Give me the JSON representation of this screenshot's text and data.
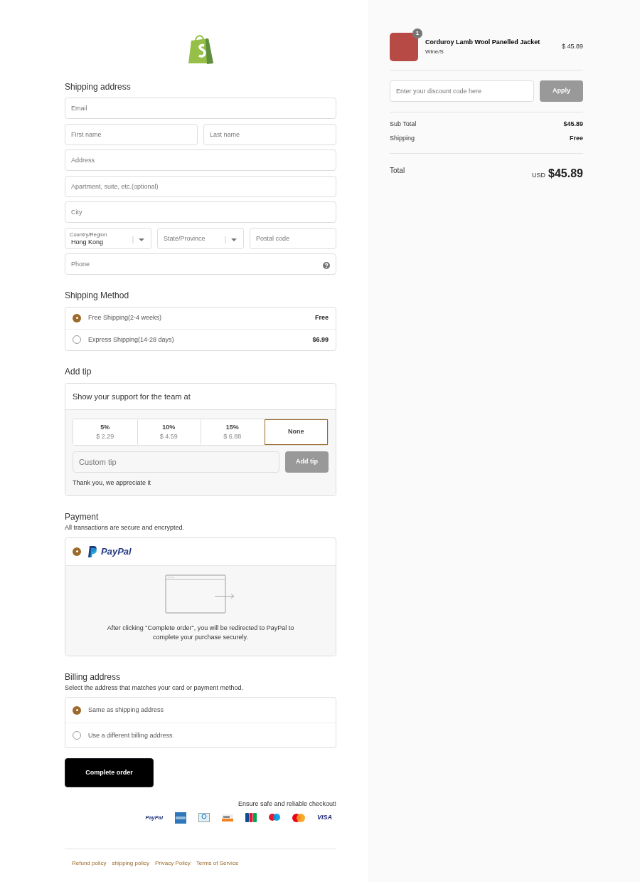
{
  "shipping_address": {
    "title": "Shipping address",
    "rows": [
      [
        {
          "kind": "text",
          "placeholder": "Email"
        }
      ],
      [
        {
          "kind": "text",
          "placeholder": "First name"
        },
        {
          "kind": "text",
          "placeholder": "Last name"
        }
      ],
      [
        {
          "kind": "text",
          "placeholder": "Address"
        }
      ],
      [
        {
          "kind": "text",
          "placeholder": "Apartment, suite, etc.(optional)"
        }
      ],
      [
        {
          "kind": "text",
          "placeholder": "City"
        }
      ],
      [
        {
          "kind": "select",
          "label": "Country/Region",
          "value": "Hong Kong"
        },
        {
          "kind": "select",
          "placeholder": "State/Province"
        },
        {
          "kind": "text",
          "placeholder": "Postal code"
        }
      ],
      [
        {
          "kind": "help",
          "placeholder": "Phone"
        }
      ]
    ]
  },
  "shipping_method": {
    "title": "Shipping Method",
    "options": [
      {
        "label": "Free Shipping(2-4 weeks)",
        "price": "Free",
        "selected": true
      },
      {
        "label": "Express Shipping(14-28 days)",
        "price": "$6.99",
        "selected": false
      }
    ]
  },
  "tip": {
    "title": "Add tip",
    "prompt": "Show your support for the team at",
    "options": [
      {
        "label": "5%",
        "amount": "$ 2.29",
        "selected": false
      },
      {
        "label": "10%",
        "amount": "$ 4.59",
        "selected": false
      },
      {
        "label": "15%",
        "amount": "$ 6.88",
        "selected": false
      },
      {
        "label": "None",
        "selected": true
      }
    ],
    "custom_placeholder": "Custom tip",
    "button": {
      "label": "Add tip",
      "disabled": true
    },
    "note": "Thank you, we appreciate it"
  },
  "payment": {
    "title": "Payment",
    "subtitle": "All transactions are secure and encrypted.",
    "methods": [
      {
        "label": "PayPal",
        "selected": true
      }
    ],
    "message": "After clicking \"Complete order\", you will be redirected to PayPal to complete your purchase securely."
  },
  "billing": {
    "title": "Billing address",
    "subtitle": "Select the address that matches your card or payment method.",
    "options": [
      {
        "label": "Same as shipping address",
        "selected": true
      },
      {
        "label": "Use a different billing address",
        "selected": false
      }
    ]
  },
  "complete_button": "Complete order",
  "trust": {
    "caption": "Ensure safe and reliable checkout!",
    "cards": [
      {
        "kind": "paypal",
        "label": "PayPal"
      },
      {
        "kind": "amex"
      },
      {
        "kind": "diners"
      },
      {
        "kind": "discover"
      },
      {
        "kind": "jcb"
      },
      {
        "kind": "maestro"
      },
      {
        "kind": "mastercard"
      },
      {
        "kind": "visa",
        "label": "VISA"
      }
    ]
  },
  "footer_links": [
    "Refund policy",
    "shipping policy",
    "Privacy Policy",
    "Terms of Service"
  ],
  "summary": {
    "item": {
      "name": "Corduroy Lamb Wool Panelled Jacket",
      "variant": "Wine/S",
      "price": "$ 45.89",
      "quantity": "1"
    },
    "discount": {
      "placeholder": "Enter your discount code here",
      "button": {
        "label": "Apply",
        "disabled": true
      }
    },
    "rows": [
      {
        "label": "Sub Total",
        "value": "$45.89"
      },
      {
        "label": "Shipping",
        "value": "Free"
      }
    ],
    "total": {
      "label": "Total",
      "currency": "USD",
      "amount": "$45.89"
    }
  }
}
